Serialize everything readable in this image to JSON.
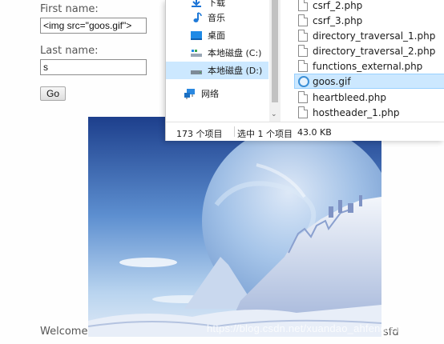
{
  "form": {
    "first_name_label": "First name:",
    "first_name_value": "<img src=\"goos.gif\">",
    "last_name_label": "Last name:",
    "last_name_value": "s",
    "go_label": "Go"
  },
  "page": {
    "welcome_text": "Welcome",
    "trailing_text": "sfd",
    "watermark": "https://blog.csdn.net/xuandao_ahfengren"
  },
  "explorer": {
    "nav_items": [
      {
        "label": "下载",
        "icon": "download-icon"
      },
      {
        "label": "音乐",
        "icon": "music-icon"
      },
      {
        "label": "桌面",
        "icon": "desktop-icon"
      },
      {
        "label": "本地磁盘 (C:)",
        "icon": "drive-c-icon"
      },
      {
        "label": "本地磁盘 (D:)",
        "icon": "drive-d-icon",
        "selected": true
      },
      {
        "label": "网络",
        "icon": "network-icon"
      }
    ],
    "files": [
      {
        "name": "csrf_2.php"
      },
      {
        "name": "csrf_3.php"
      },
      {
        "name": "directory_traversal_1.php"
      },
      {
        "name": "directory_traversal_2.php"
      },
      {
        "name": "functions_external.php"
      },
      {
        "name": "goos.gif",
        "selected": true
      },
      {
        "name": "heartbleed.php"
      },
      {
        "name": "hostheader_1.php"
      }
    ],
    "status": {
      "item_count": "173 个项目",
      "selection": "选中 1 个项目",
      "size": "43.0 KB"
    }
  },
  "colors": {
    "selection": "#cce8ff",
    "selection_border": "#99d1ff",
    "sky_top": "#1d3f8c",
    "snow": "#e8eef8"
  }
}
